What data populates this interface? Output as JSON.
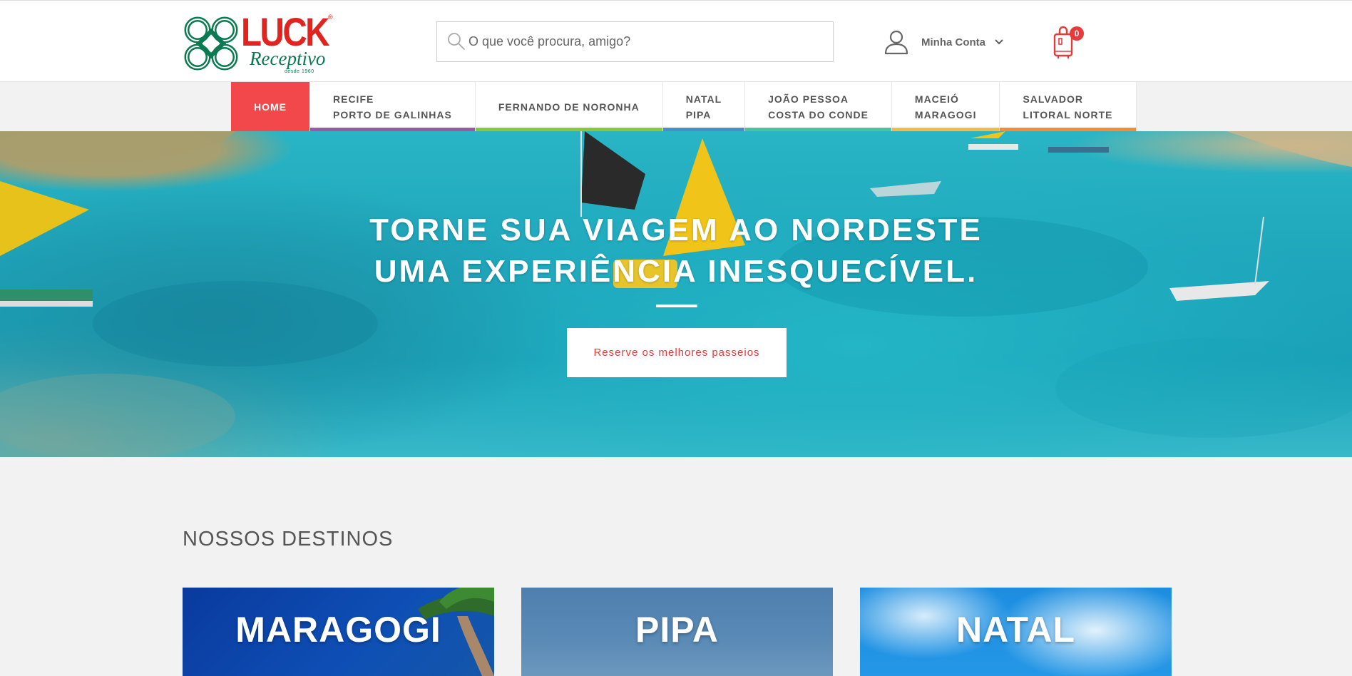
{
  "brand": {
    "name": "LUCK",
    "registered": "®",
    "subtitle": "Receptivo",
    "since": "desde 1960",
    "colors": {
      "red": "#e2241f",
      "green": "#0b7a52"
    }
  },
  "search": {
    "placeholder": "O que você procura, amigo?"
  },
  "account": {
    "label": "Minha Conta"
  },
  "cart": {
    "count": "0"
  },
  "nav": {
    "items": [
      {
        "label": "HOME",
        "accent": "#f2474b"
      },
      {
        "label": "RECIFE\nPORTO DE GALINHAS",
        "accent": "#9b59a6"
      },
      {
        "label": "FERNANDO DE NORONHA",
        "accent": "#8cc63f"
      },
      {
        "label": "NATAL\nPIPA",
        "accent": "#4a90c8"
      },
      {
        "label": "JOÃO PESSOA\nCOSTA DO CONDE",
        "accent": "#4cc2a0"
      },
      {
        "label": "MACEIÓ\nMARAGOGI",
        "accent": "#f6b84a"
      },
      {
        "label": "SALVADOR\nLITORAL NORTE",
        "accent": "#f28c3a"
      }
    ]
  },
  "hero": {
    "title_line1": "TORNE SUA VIAGEM AO NORDESTE",
    "title_line2": "UMA EXPERIÊNCIA INESQUECÍVEL.",
    "cta": "Reserve os melhores passeios"
  },
  "destinations": {
    "heading": "NOSSOS DESTINOS",
    "cards": [
      {
        "title": "MARAGOGI"
      },
      {
        "title": "PIPA"
      },
      {
        "title": "NATAL"
      }
    ]
  }
}
